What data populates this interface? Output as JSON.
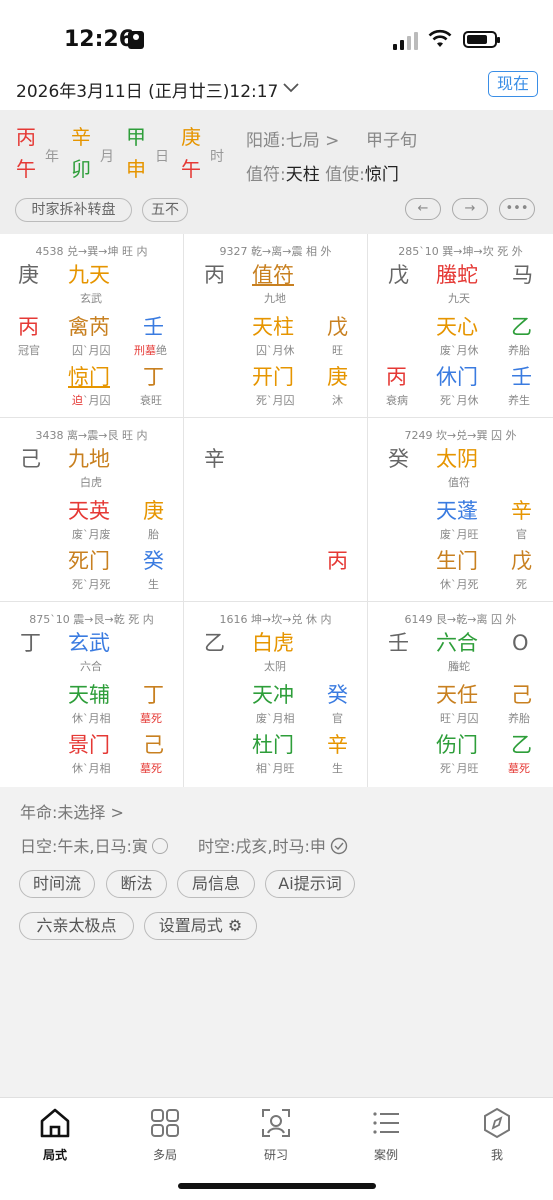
{
  "status": {
    "time": "12:26"
  },
  "header": {
    "date": "2026年3月11日 (正月廿三)12:17",
    "now_label": "现在"
  },
  "pillars": {
    "top": [
      "丙",
      "辛",
      "甲",
      "庚"
    ],
    "bottom": [
      "午",
      "卯",
      "申",
      "午"
    ],
    "labels": [
      "年",
      "月",
      "日",
      "时"
    ]
  },
  "info": {
    "ju": "阳遁:七局 >",
    "xunshou": "甲子旬",
    "zhifu_label": "值符:",
    "zhifu_value": "天柱",
    "zhishi_label": " 值使:",
    "zhishi_value": "惊门"
  },
  "tags": {
    "t1": "时家拆补转盘",
    "t2": "五不"
  },
  "nav": {
    "prev": "←",
    "next": "→",
    "more": "•••"
  },
  "grid": {
    "c0": {
      "hdr": "4538 兑→巽→坤 旺 内",
      "a": "庚",
      "b": "九天",
      "b_sub": "玄武",
      "c": "丙",
      "c_sub": "冠官",
      "d": "禽芮",
      "d_sub": "囚`月囚",
      "e": "壬",
      "e_sub1": "刑墓",
      "e_sub2": "绝",
      "f": "惊门",
      "f_sub1": "迫",
      "f_sub2": "`月囚",
      "g": "丁",
      "g_sub": "衰旺"
    },
    "c1": {
      "hdr": "9327 乾→离→震 相 外",
      "a": "丙",
      "b": "值符",
      "b_sub": "九地",
      "d": "天柱",
      "d_sub": "囚`月休",
      "e": "戊",
      "e_sub": "旺",
      "f": "开门",
      "f_sub": "死`月囚",
      "g": "庚",
      "g_sub": "沐"
    },
    "c2": {
      "hdr": "285`10 巽→坤→坎 死 外",
      "a": "戊",
      "b": "螣蛇",
      "b_sub": "九天",
      "h": "马",
      "d": "天心",
      "d_sub": "废`月休",
      "e": "乙",
      "e_sub": "养胎",
      "c": "丙",
      "c_sub": "衰病",
      "f": "休门",
      "f_sub": "死`月休",
      "g": "壬",
      "g_sub": "养生"
    },
    "c3": {
      "hdr": "3438 离→震→艮 旺 内",
      "a": "己",
      "b": "九地",
      "b_sub": "白虎",
      "d": "天英",
      "d_sub": "废`月废",
      "e": "庚",
      "e_sub": "胎",
      "f": "死门",
      "f_sub": "死`月死",
      "g": "癸",
      "g_sub": "生"
    },
    "c4": {
      "a": "辛",
      "g": "丙"
    },
    "c5": {
      "hdr": "7249 坎→兑→巽 囚 外",
      "a": "癸",
      "b": "太阴",
      "b_sub": "值符",
      "d": "天蓬",
      "d_sub": "废`月旺",
      "e": "辛",
      "e_sub": "官",
      "f": "生门",
      "f_sub": "休`月死",
      "g": "戊",
      "g_sub": "死"
    },
    "c6": {
      "hdr": "875`10 震→艮→乾 死 内",
      "a": "丁",
      "b": "玄武",
      "b_sub": "六合",
      "d": "天辅",
      "d_sub": "休`月相",
      "e": "丁",
      "e_sub": "墓死",
      "f": "景门",
      "f_sub": "休`月相",
      "g": "己",
      "g_sub": "墓死"
    },
    "c7": {
      "hdr": "1616 坤→坎→兑 休 内",
      "a": "乙",
      "b": "白虎",
      "b_sub": "太阴",
      "d": "天冲",
      "d_sub": "废`月相",
      "e": "癸",
      "e_sub": "官",
      "f": "杜门",
      "f_sub": "相`月旺",
      "g": "辛",
      "g_sub": "生"
    },
    "c8": {
      "hdr": "6149 艮→乾→离 囚 外",
      "a": "壬",
      "b": "六合",
      "b_sub": "螣蛇",
      "h": "O",
      "d": "天任",
      "d_sub": "旺`月囚",
      "e": "己",
      "e_sub": "养胎",
      "f": "伤门",
      "f_sub": "死`月旺",
      "g": "乙",
      "g_sub": "墓死"
    }
  },
  "bottom": {
    "nianming": "年命:未选择 >",
    "rikong": "日空:午未,日马:寅",
    "shikong": "时空:戌亥,时马:申",
    "tags": [
      "时间流",
      "断法",
      "局信息",
      "Ai提示词",
      "六亲太极点",
      "设置局式 ⚙"
    ]
  },
  "tabs": [
    "局式",
    "多局",
    "研习",
    "案例",
    "我"
  ],
  "colors": {
    "accent": "#3a8ee6",
    "red": "#e53935",
    "orange": "#e69500",
    "green": "#2e9e3a",
    "blue": "#3a7be0",
    "brown": "#c88020"
  }
}
